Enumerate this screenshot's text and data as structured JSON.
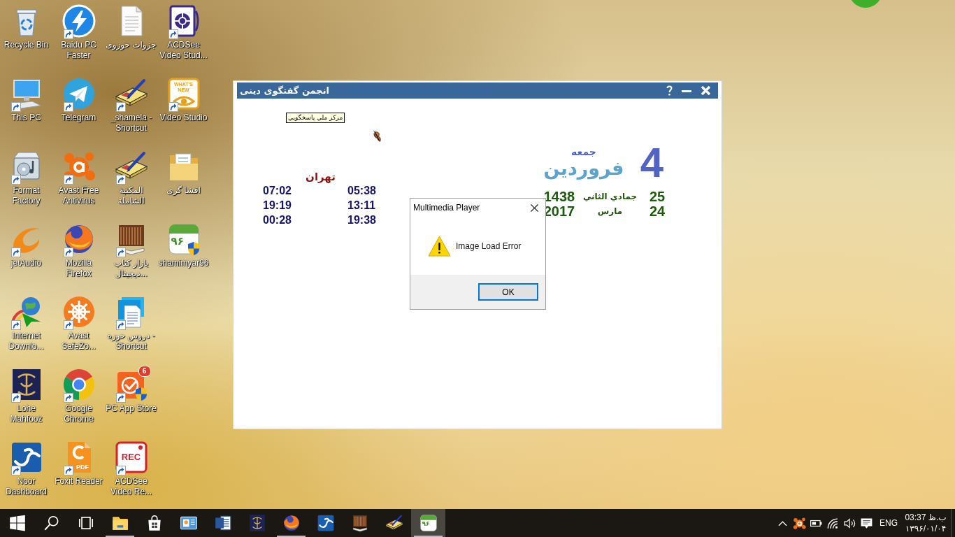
{
  "desktop": {
    "icons": [
      {
        "kind": "recycle_bin",
        "lines": [
          "Recycle Bin"
        ],
        "shortcut": false
      },
      {
        "kind": "computer",
        "lines": [
          "This PC"
        ],
        "shortcut": true
      },
      {
        "kind": "format_factory",
        "lines": [
          "Format",
          "Factory"
        ],
        "shortcut": true
      },
      {
        "kind": "jetaudio",
        "lines": [
          "jetAudio"
        ],
        "shortcut": true
      },
      {
        "kind": "download_manager",
        "lines": [
          "Internet",
          "Downlo..."
        ],
        "shortcut": true
      },
      {
        "kind": "emblem",
        "lines": [
          "Lohe",
          "Mahfooz"
        ],
        "shortcut": true
      },
      {
        "kind": "noor",
        "lines": [
          "Noor",
          "Dashboard"
        ],
        "shortcut": true
      },
      {
        "kind": "lightning",
        "lines": [
          "Baidu PC",
          "Faster"
        ],
        "shortcut": true
      },
      {
        "kind": "telegram",
        "lines": [
          "Telegram"
        ],
        "shortcut": true
      },
      {
        "kind": "avast",
        "lines": [
          "Avast Free",
          "Antivirus"
        ],
        "shortcut": true
      },
      {
        "kind": "firefox",
        "lines": [
          "Mozilla",
          "Firefox"
        ],
        "shortcut": true
      },
      {
        "kind": "ship_wheel",
        "lines": [
          "Avast",
          "SafeZo..."
        ],
        "shortcut": true
      },
      {
        "kind": "chrome",
        "lines": [
          "Google",
          "Chrome"
        ],
        "shortcut": true
      },
      {
        "kind": "foxit",
        "lines": [
          "Foxit Reader"
        ],
        "shortcut": true,
        "logo_text": "PDF"
      },
      {
        "kind": "document",
        "lines": [
          "جزوات حوزوی"
        ],
        "shortcut": false
      },
      {
        "kind": "book_pen",
        "lines": [
          "_shamela -",
          "Shortcut"
        ],
        "shortcut": true
      },
      {
        "kind": "book_pen",
        "lines": [
          "المكتبة",
          "الشاملة"
        ],
        "shortcut": true
      },
      {
        "kind": "bookshelf",
        "lines": [
          "بازار كتاب",
          "ديجيتال..."
        ],
        "shortcut": true
      },
      {
        "kind": "documents",
        "lines": [
          "دروس حوزه -",
          "Shortcut"
        ],
        "shortcut": true
      },
      {
        "kind": "app_store",
        "lines": [
          "PC App Store"
        ],
        "shortcut": true,
        "badge": "6"
      },
      {
        "kind": "rec",
        "lines": [
          "ACDSee",
          "Video Re..."
        ],
        "shortcut": true,
        "logo_text": "REC"
      },
      {
        "kind": "aperture",
        "lines": [
          "ACDSee",
          "Video Stud..."
        ],
        "shortcut": true
      },
      {
        "kind": "whats_new",
        "lines": [
          "Video Studio"
        ],
        "shortcut": true,
        "logo_text": "WHAT'S NEW"
      },
      {
        "kind": "folder",
        "lines": [
          "افشا گری"
        ],
        "shortcut": false
      },
      {
        "kind": "calendar",
        "lines": [
          "shamimyar96"
        ],
        "shortcut": false,
        "logo_text": "۹۶"
      }
    ]
  },
  "app_window": {
    "title": "انجمن گفتگوی دینی",
    "tooltip": "مركز ملي پاسخگويي",
    "city": "تهران",
    "times": [
      {
        "column_1": "07:02",
        "column_2": "05:38"
      },
      {
        "column_1": "19:19",
        "column_2": "13:11"
      },
      {
        "column_1": "00:28",
        "column_2": "19:38"
      }
    ],
    "date": {
      "weekday": "جمعه",
      "day": "4",
      "month": "فروردین",
      "hijri": {
        "year": "1438",
        "month": "جمادي الثاني",
        "day": "25"
      },
      "gregorian": {
        "year": "2017",
        "month": "مارس",
        "day": "24"
      }
    }
  },
  "dialog": {
    "title": "Multimedia Player",
    "message": "Image Load Error",
    "button": "OK"
  },
  "taskbar": {
    "items": [
      {
        "kind": "start",
        "running": false,
        "active": false
      },
      {
        "kind": "search",
        "running": false,
        "active": false
      },
      {
        "kind": "task_view",
        "running": false,
        "active": false
      },
      {
        "kind": "explorer",
        "running": true,
        "active": false
      },
      {
        "kind": "store",
        "running": false,
        "active": false
      },
      {
        "kind": "presentation",
        "running": false,
        "active": false
      },
      {
        "kind": "word",
        "running": false,
        "active": false
      },
      {
        "kind": "emblem",
        "running": false,
        "active": false
      },
      {
        "kind": "firefox",
        "running": true,
        "active": false
      },
      {
        "kind": "noor",
        "running": false,
        "active": false
      },
      {
        "kind": "bookshelf",
        "running": false,
        "active": false
      },
      {
        "kind": "book_pen",
        "running": false,
        "active": false
      },
      {
        "kind": "calendar",
        "running": true,
        "active": true,
        "logo_text": "۹۶"
      }
    ],
    "tray": {
      "icons": [
        {
          "kind": "chevron"
        },
        {
          "kind": "avast"
        },
        {
          "kind": "battery"
        },
        {
          "kind": "wifi"
        },
        {
          "kind": "volume"
        },
        {
          "kind": "notifications"
        }
      ],
      "language": "ENG",
      "clock": {
        "time": "03:37 ب.ظ",
        "date": "۱۳۹۶/۰۱/۰۴"
      }
    }
  }
}
